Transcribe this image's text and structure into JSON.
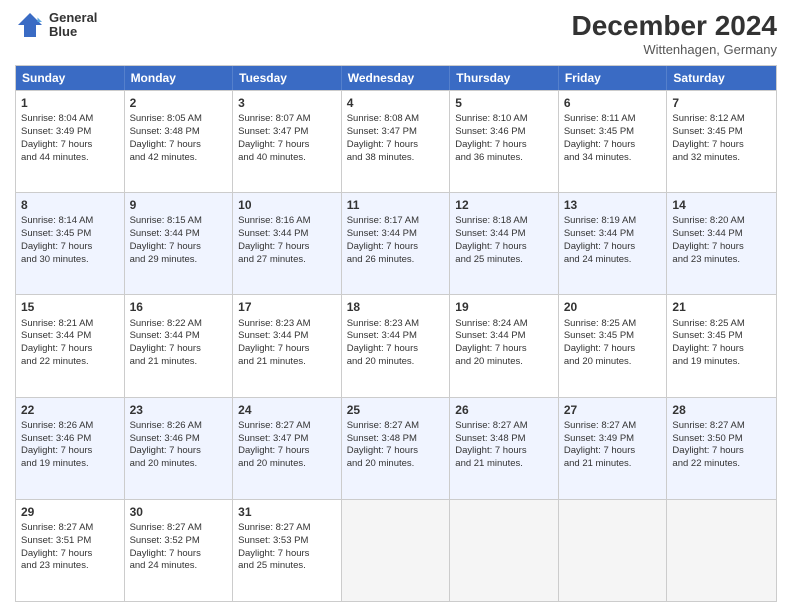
{
  "header": {
    "logo_line1": "General",
    "logo_line2": "Blue",
    "month_title": "December 2024",
    "location": "Wittenhagen, Germany"
  },
  "days_of_week": [
    "Sunday",
    "Monday",
    "Tuesday",
    "Wednesday",
    "Thursday",
    "Friday",
    "Saturday"
  ],
  "weeks": [
    [
      {
        "day": "1",
        "lines": [
          "Sunrise: 8:04 AM",
          "Sunset: 3:49 PM",
          "Daylight: 7 hours",
          "and 44 minutes."
        ]
      },
      {
        "day": "2",
        "lines": [
          "Sunrise: 8:05 AM",
          "Sunset: 3:48 PM",
          "Daylight: 7 hours",
          "and 42 minutes."
        ]
      },
      {
        "day": "3",
        "lines": [
          "Sunrise: 8:07 AM",
          "Sunset: 3:47 PM",
          "Daylight: 7 hours",
          "and 40 minutes."
        ]
      },
      {
        "day": "4",
        "lines": [
          "Sunrise: 8:08 AM",
          "Sunset: 3:47 PM",
          "Daylight: 7 hours",
          "and 38 minutes."
        ]
      },
      {
        "day": "5",
        "lines": [
          "Sunrise: 8:10 AM",
          "Sunset: 3:46 PM",
          "Daylight: 7 hours",
          "and 36 minutes."
        ]
      },
      {
        "day": "6",
        "lines": [
          "Sunrise: 8:11 AM",
          "Sunset: 3:45 PM",
          "Daylight: 7 hours",
          "and 34 minutes."
        ]
      },
      {
        "day": "7",
        "lines": [
          "Sunrise: 8:12 AM",
          "Sunset: 3:45 PM",
          "Daylight: 7 hours",
          "and 32 minutes."
        ]
      }
    ],
    [
      {
        "day": "8",
        "lines": [
          "Sunrise: 8:14 AM",
          "Sunset: 3:45 PM",
          "Daylight: 7 hours",
          "and 30 minutes."
        ]
      },
      {
        "day": "9",
        "lines": [
          "Sunrise: 8:15 AM",
          "Sunset: 3:44 PM",
          "Daylight: 7 hours",
          "and 29 minutes."
        ]
      },
      {
        "day": "10",
        "lines": [
          "Sunrise: 8:16 AM",
          "Sunset: 3:44 PM",
          "Daylight: 7 hours",
          "and 27 minutes."
        ]
      },
      {
        "day": "11",
        "lines": [
          "Sunrise: 8:17 AM",
          "Sunset: 3:44 PM",
          "Daylight: 7 hours",
          "and 26 minutes."
        ]
      },
      {
        "day": "12",
        "lines": [
          "Sunrise: 8:18 AM",
          "Sunset: 3:44 PM",
          "Daylight: 7 hours",
          "and 25 minutes."
        ]
      },
      {
        "day": "13",
        "lines": [
          "Sunrise: 8:19 AM",
          "Sunset: 3:44 PM",
          "Daylight: 7 hours",
          "and 24 minutes."
        ]
      },
      {
        "day": "14",
        "lines": [
          "Sunrise: 8:20 AM",
          "Sunset: 3:44 PM",
          "Daylight: 7 hours",
          "and 23 minutes."
        ]
      }
    ],
    [
      {
        "day": "15",
        "lines": [
          "Sunrise: 8:21 AM",
          "Sunset: 3:44 PM",
          "Daylight: 7 hours",
          "and 22 minutes."
        ]
      },
      {
        "day": "16",
        "lines": [
          "Sunrise: 8:22 AM",
          "Sunset: 3:44 PM",
          "Daylight: 7 hours",
          "and 21 minutes."
        ]
      },
      {
        "day": "17",
        "lines": [
          "Sunrise: 8:23 AM",
          "Sunset: 3:44 PM",
          "Daylight: 7 hours",
          "and 21 minutes."
        ]
      },
      {
        "day": "18",
        "lines": [
          "Sunrise: 8:23 AM",
          "Sunset: 3:44 PM",
          "Daylight: 7 hours",
          "and 20 minutes."
        ]
      },
      {
        "day": "19",
        "lines": [
          "Sunrise: 8:24 AM",
          "Sunset: 3:44 PM",
          "Daylight: 7 hours",
          "and 20 minutes."
        ]
      },
      {
        "day": "20",
        "lines": [
          "Sunrise: 8:25 AM",
          "Sunset: 3:45 PM",
          "Daylight: 7 hours",
          "and 20 minutes."
        ]
      },
      {
        "day": "21",
        "lines": [
          "Sunrise: 8:25 AM",
          "Sunset: 3:45 PM",
          "Daylight: 7 hours",
          "and 19 minutes."
        ]
      }
    ],
    [
      {
        "day": "22",
        "lines": [
          "Sunrise: 8:26 AM",
          "Sunset: 3:46 PM",
          "Daylight: 7 hours",
          "and 19 minutes."
        ]
      },
      {
        "day": "23",
        "lines": [
          "Sunrise: 8:26 AM",
          "Sunset: 3:46 PM",
          "Daylight: 7 hours",
          "and 20 minutes."
        ]
      },
      {
        "day": "24",
        "lines": [
          "Sunrise: 8:27 AM",
          "Sunset: 3:47 PM",
          "Daylight: 7 hours",
          "and 20 minutes."
        ]
      },
      {
        "day": "25",
        "lines": [
          "Sunrise: 8:27 AM",
          "Sunset: 3:48 PM",
          "Daylight: 7 hours",
          "and 20 minutes."
        ]
      },
      {
        "day": "26",
        "lines": [
          "Sunrise: 8:27 AM",
          "Sunset: 3:48 PM",
          "Daylight: 7 hours",
          "and 21 minutes."
        ]
      },
      {
        "day": "27",
        "lines": [
          "Sunrise: 8:27 AM",
          "Sunset: 3:49 PM",
          "Daylight: 7 hours",
          "and 21 minutes."
        ]
      },
      {
        "day": "28",
        "lines": [
          "Sunrise: 8:27 AM",
          "Sunset: 3:50 PM",
          "Daylight: 7 hours",
          "and 22 minutes."
        ]
      }
    ],
    [
      {
        "day": "29",
        "lines": [
          "Sunrise: 8:27 AM",
          "Sunset: 3:51 PM",
          "Daylight: 7 hours",
          "and 23 minutes."
        ]
      },
      {
        "day": "30",
        "lines": [
          "Sunrise: 8:27 AM",
          "Sunset: 3:52 PM",
          "Daylight: 7 hours",
          "and 24 minutes."
        ]
      },
      {
        "day": "31",
        "lines": [
          "Sunrise: 8:27 AM",
          "Sunset: 3:53 PM",
          "Daylight: 7 hours",
          "and 25 minutes."
        ]
      },
      {
        "day": "",
        "lines": []
      },
      {
        "day": "",
        "lines": []
      },
      {
        "day": "",
        "lines": []
      },
      {
        "day": "",
        "lines": []
      }
    ]
  ]
}
